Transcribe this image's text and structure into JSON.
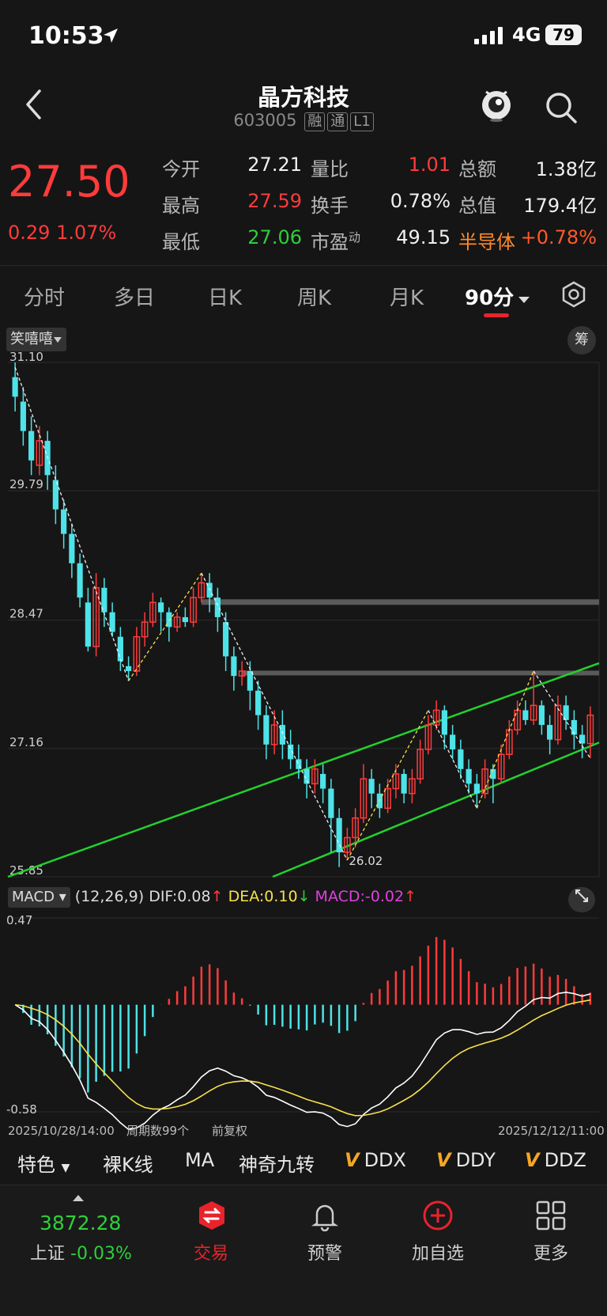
{
  "status_bar": {
    "time": "10:53",
    "network": "4G",
    "battery": "79"
  },
  "header": {
    "title": "晶方科技",
    "code": "603005",
    "tags": [
      "融",
      "通",
      "L1"
    ]
  },
  "quote": {
    "price": "27.50",
    "change": "0.29",
    "change_pct": "1.07%",
    "rows": [
      [
        {
          "label": "今开",
          "value": "27.21",
          "color": "#f0f0f0"
        },
        {
          "label": "量比",
          "value": "1.01",
          "color": "#ff3b3b"
        },
        {
          "label": "总额",
          "value": "1.38亿",
          "color": "#f0f0f0"
        }
      ],
      [
        {
          "label": "最高",
          "value": "27.59",
          "color": "#ff3b3b"
        },
        {
          "label": "换手",
          "value": "0.78%",
          "color": "#f0f0f0"
        },
        {
          "label": "总值",
          "value": "179.4亿",
          "color": "#f0f0f0"
        }
      ],
      [
        {
          "label": "最低",
          "value": "27.06",
          "color": "#2fcf3b"
        },
        {
          "label": "市盈",
          "label_sup": "动",
          "value": "49.15",
          "color": "#f0f0f0"
        },
        {
          "label": "半导体",
          "value": "+0.78%",
          "color": "#ff5a2a"
        }
      ]
    ]
  },
  "tabs": [
    "分时",
    "多日",
    "日K",
    "周K",
    "月K",
    "90分"
  ],
  "chart": {
    "indicator_button": "笑嘻嘻",
    "chip_button": "筹",
    "y_ticks": [
      "31.10",
      "29.79",
      "28.47",
      "27.16",
      "25.85"
    ],
    "low_label": "26.02",
    "x_start": "2025/10/28/14:00",
    "period_count": "周期数99个",
    "adjust": "前复权",
    "x_end": "2025/12/12/11:00",
    "colors": {
      "up": "#ff3b3b",
      "down": "#4de3e8",
      "channel": "#22d22e",
      "resist": "#5a5a5a"
    }
  },
  "macd": {
    "name": "MACD",
    "params": "(12,26,9)",
    "dif": "DIF:0.08",
    "dea": "DEA:0.10",
    "macd": "MACD:-0.02",
    "y_top": "0.47",
    "y_bottom": "-0.58"
  },
  "indicators": [
    "特色",
    "裸K线",
    "MA",
    "神奇九转",
    "DDX",
    "DDY",
    "DDZ"
  ],
  "bottom_nav": {
    "index_value": "3872.28",
    "index_name": "上证",
    "index_change": "-0.03%",
    "items": [
      "交易",
      "预警",
      "加自选",
      "更多"
    ]
  },
  "chart_data": {
    "type": "candlestick",
    "timeframe": "90分",
    "x_range": [
      "2025/10/28/14:00",
      "2025/12/12/11:00"
    ],
    "ylim": [
      25.85,
      31.1
    ],
    "count": 99,
    "candles": [
      [
        30.95,
        30.75,
        31.1,
        30.6
      ],
      [
        30.7,
        30.4,
        30.85,
        30.25
      ],
      [
        30.4,
        30.1,
        30.55,
        29.95
      ],
      [
        30.05,
        30.3,
        30.45,
        29.95
      ],
      [
        30.3,
        29.95,
        30.4,
        29.8
      ],
      [
        29.9,
        29.6,
        30.05,
        29.45
      ],
      [
        29.6,
        29.35,
        29.7,
        29.2
      ],
      [
        29.35,
        29.05,
        29.45,
        28.9
      ],
      [
        29.05,
        28.7,
        29.15,
        28.6
      ],
      [
        28.65,
        28.2,
        28.8,
        28.15
      ],
      [
        28.2,
        28.8,
        28.95,
        28.1
      ],
      [
        28.8,
        28.55,
        28.9,
        28.4
      ],
      [
        28.55,
        28.35,
        28.65,
        28.3
      ],
      [
        28.3,
        28.05,
        28.4,
        27.95
      ],
      [
        28.0,
        27.95,
        28.1,
        27.85
      ],
      [
        27.95,
        28.3,
        28.4,
        27.9
      ],
      [
        28.3,
        28.45,
        28.55,
        28.2
      ],
      [
        28.45,
        28.65,
        28.75,
        28.4
      ],
      [
        28.65,
        28.55,
        28.7,
        28.35
      ],
      [
        28.55,
        28.4,
        28.6,
        28.25
      ],
      [
        28.4,
        28.5,
        28.55,
        28.35
      ],
      [
        28.5,
        28.45,
        28.6,
        28.4
      ],
      [
        28.45,
        28.7,
        28.8,
        28.4
      ],
      [
        28.7,
        28.85,
        28.95,
        28.65
      ],
      [
        28.85,
        28.7,
        28.95,
        28.55
      ],
      [
        28.7,
        28.5,
        28.8,
        28.35
      ],
      [
        28.45,
        28.1,
        28.55,
        27.95
      ],
      [
        28.1,
        27.9,
        28.2,
        27.75
      ],
      [
        27.9,
        27.95,
        28.05,
        27.8
      ],
      [
        27.95,
        27.75,
        28.05,
        27.55
      ],
      [
        27.75,
        27.5,
        27.85,
        27.35
      ],
      [
        27.5,
        27.2,
        27.6,
        27.05
      ],
      [
        27.2,
        27.4,
        27.55,
        27.1
      ],
      [
        27.4,
        27.2,
        27.55,
        27.05
      ],
      [
        27.2,
        27.05,
        27.35,
        26.95
      ],
      [
        27.05,
        26.95,
        27.2,
        26.85
      ],
      [
        26.95,
        26.8,
        27.05,
        26.65
      ],
      [
        26.8,
        26.95,
        27.05,
        26.7
      ],
      [
        26.9,
        26.75,
        27.0,
        26.6
      ],
      [
        26.75,
        26.45,
        26.85,
        26.1
      ],
      [
        26.45,
        26.1,
        26.55,
        25.95
      ],
      [
        26.1,
        26.25,
        26.35,
        26.02
      ],
      [
        26.25,
        26.45,
        26.55,
        26.15
      ],
      [
        26.45,
        26.85,
        27.0,
        26.4
      ],
      [
        26.85,
        26.7,
        26.95,
        26.55
      ],
      [
        26.7,
        26.55,
        26.8,
        26.45
      ],
      [
        26.55,
        26.75,
        26.85,
        26.5
      ],
      [
        26.75,
        26.9,
        27.0,
        26.65
      ],
      [
        26.9,
        26.7,
        26.95,
        26.6
      ],
      [
        26.7,
        26.85,
        26.95,
        26.6
      ],
      [
        26.85,
        27.15,
        27.25,
        26.8
      ],
      [
        27.15,
        27.4,
        27.5,
        27.1
      ],
      [
        27.4,
        27.55,
        27.65,
        27.35
      ],
      [
        27.55,
        27.3,
        27.6,
        27.15
      ],
      [
        27.3,
        27.15,
        27.4,
        27.05
      ],
      [
        27.15,
        26.95,
        27.25,
        26.85
      ],
      [
        26.95,
        26.8,
        27.05,
        26.7
      ],
      [
        26.8,
        26.7,
        26.9,
        26.55
      ],
      [
        26.7,
        26.95,
        27.05,
        26.65
      ],
      [
        26.95,
        26.85,
        27.0,
        26.6
      ],
      [
        26.85,
        27.1,
        27.2,
        26.8
      ],
      [
        27.1,
        27.35,
        27.45,
        27.05
      ],
      [
        27.35,
        27.55,
        27.65,
        27.3
      ],
      [
        27.55,
        27.45,
        27.65,
        27.4
      ],
      [
        27.45,
        27.6,
        27.95,
        27.4
      ],
      [
        27.6,
        27.4,
        27.65,
        27.3
      ],
      [
        27.4,
        27.25,
        27.5,
        27.1
      ],
      [
        27.25,
        27.6,
        27.7,
        27.2
      ],
      [
        27.6,
        27.45,
        27.7,
        27.35
      ],
      [
        27.45,
        27.3,
        27.55,
        27.15
      ],
      [
        27.3,
        27.21,
        27.4,
        27.06
      ],
      [
        27.21,
        27.5,
        27.59,
        27.06
      ]
    ]
  }
}
